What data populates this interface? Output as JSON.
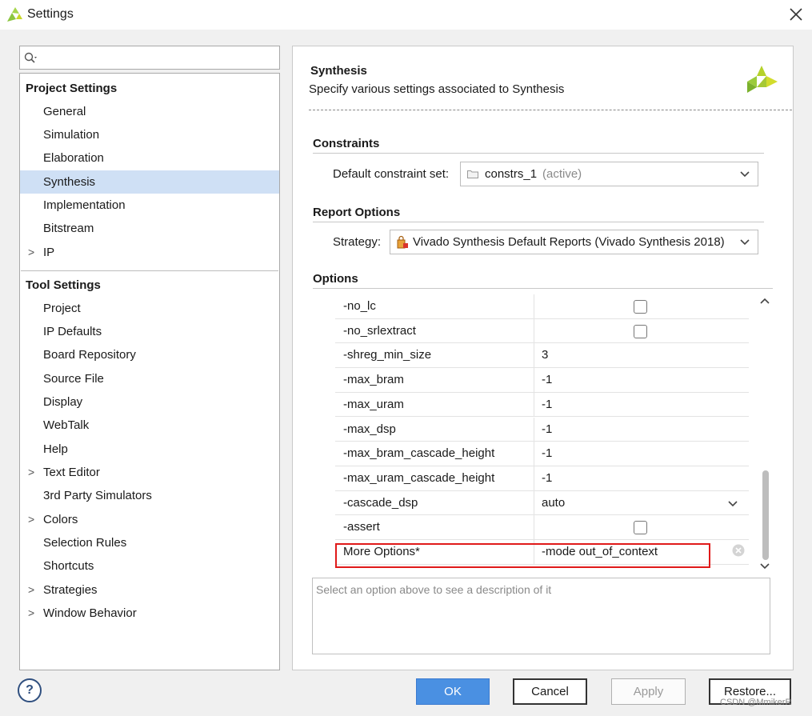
{
  "window": {
    "title": "Settings"
  },
  "search": {
    "placeholder": ""
  },
  "tree": {
    "project_header": "Project Settings",
    "project_items": [
      {
        "label": "General",
        "expandable": false
      },
      {
        "label": "Simulation",
        "expandable": false
      },
      {
        "label": "Elaboration",
        "expandable": false
      },
      {
        "label": "Synthesis",
        "expandable": false,
        "selected": true
      },
      {
        "label": "Implementation",
        "expandable": false
      },
      {
        "label": "Bitstream",
        "expandable": false
      },
      {
        "label": "IP",
        "expandable": true
      }
    ],
    "tool_header": "Tool Settings",
    "tool_items": [
      {
        "label": "Project",
        "expandable": false
      },
      {
        "label": "IP Defaults",
        "expandable": false
      },
      {
        "label": "Board Repository",
        "expandable": false
      },
      {
        "label": "Source File",
        "expandable": false
      },
      {
        "label": "Display",
        "expandable": false
      },
      {
        "label": "WebTalk",
        "expandable": false
      },
      {
        "label": "Help",
        "expandable": false
      },
      {
        "label": "Text Editor",
        "expandable": true
      },
      {
        "label": "3rd Party Simulators",
        "expandable": false
      },
      {
        "label": "Colors",
        "expandable": true
      },
      {
        "label": "Selection Rules",
        "expandable": false
      },
      {
        "label": "Shortcuts",
        "expandable": false
      },
      {
        "label": "Strategies",
        "expandable": true
      },
      {
        "label": "Window Behavior",
        "expandable": true
      }
    ],
    "expand_glyph": ">"
  },
  "panel": {
    "title": "Synthesis",
    "subtitle": "Specify various settings associated to Synthesis",
    "constraints": {
      "section": "Constraints",
      "label": "Default constraint set:",
      "value": "constrs_1",
      "value_note": "(active)"
    },
    "report": {
      "section": "Report Options",
      "label": "Strategy:",
      "value": "Vivado Synthesis Default Reports (Vivado Synthesis 2018)"
    },
    "options": {
      "section": "Options",
      "rows": [
        {
          "key": "-no_lc",
          "type": "checkbox",
          "checked": false
        },
        {
          "key": "-no_srlextract",
          "type": "checkbox",
          "checked": false
        },
        {
          "key": "-shreg_min_size",
          "type": "text",
          "value": "3"
        },
        {
          "key": "-max_bram",
          "type": "text",
          "value": "-1"
        },
        {
          "key": "-max_uram",
          "type": "text",
          "value": "-1"
        },
        {
          "key": "-max_dsp",
          "type": "text",
          "value": "-1"
        },
        {
          "key": "-max_bram_cascade_height",
          "type": "text",
          "value": "-1"
        },
        {
          "key": "-max_uram_cascade_height",
          "type": "text",
          "value": "-1"
        },
        {
          "key": "-cascade_dsp",
          "type": "select",
          "value": "auto"
        },
        {
          "key": "-assert",
          "type": "checkbox",
          "checked": false
        },
        {
          "key": "More Options*",
          "type": "text",
          "value": "-mode out_of_context"
        }
      ]
    },
    "description_placeholder": "Select an option above to see a description of it"
  },
  "buttons": {
    "help": "?",
    "ok": "OK",
    "cancel": "Cancel",
    "apply": "Apply",
    "restore": "Restore..."
  },
  "watermark": "CSDN @MmikerR",
  "colors": {
    "selection": "#cfe0f5",
    "ok_button": "#4a90e2",
    "highlight_border": "#e01a1a",
    "logo_green": "#8cc63f"
  }
}
